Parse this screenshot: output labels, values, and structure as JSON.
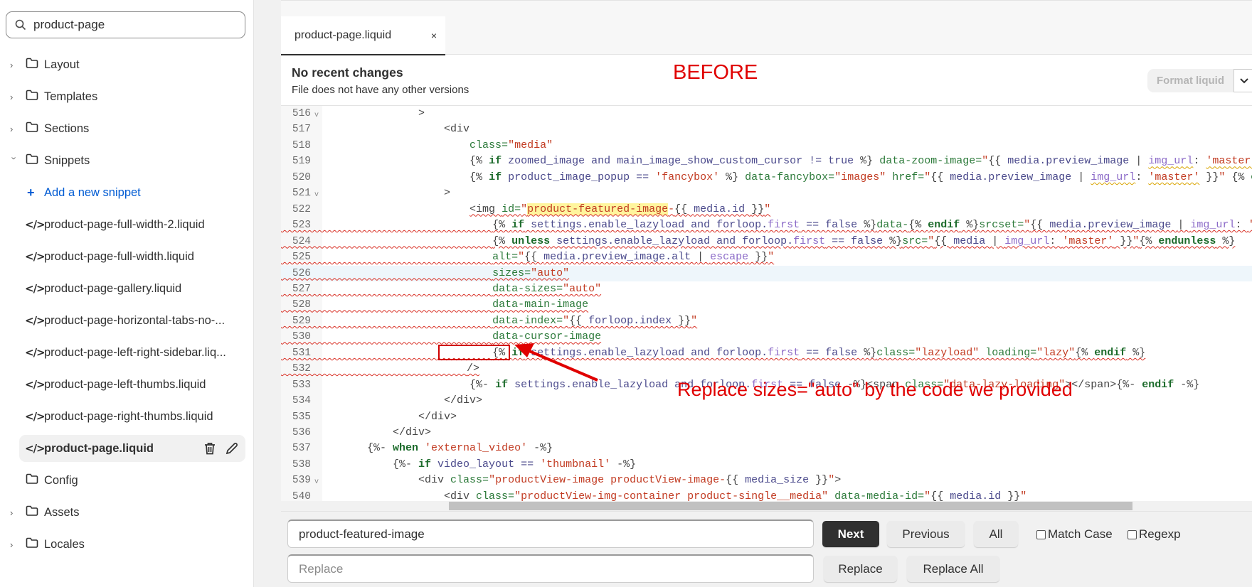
{
  "sidebar": {
    "search_value": "product-page",
    "items": [
      {
        "label": "Layout",
        "type": "folder",
        "chevron": "right"
      },
      {
        "label": "Templates",
        "type": "folder",
        "chevron": "right"
      },
      {
        "label": "Sections",
        "type": "folder",
        "chevron": "right"
      },
      {
        "label": "Snippets",
        "type": "folder",
        "chevron": "down"
      },
      {
        "label": "Add a new snippet",
        "type": "add"
      },
      {
        "label": "product-page-full-width-2.liquid",
        "type": "file"
      },
      {
        "label": "product-page-full-width.liquid",
        "type": "file"
      },
      {
        "label": "product-page-gallery.liquid",
        "type": "file"
      },
      {
        "label": "product-page-horizontal-tabs-no-...",
        "type": "file"
      },
      {
        "label": "product-page-left-right-sidebar.liq...",
        "type": "file"
      },
      {
        "label": "product-page-left-thumbs.liquid",
        "type": "file"
      },
      {
        "label": "product-page-right-thumbs.liquid",
        "type": "file"
      },
      {
        "label": "product-page.liquid",
        "type": "file",
        "active": true
      },
      {
        "label": "Config",
        "type": "folder",
        "chevron": "none"
      },
      {
        "label": "Assets",
        "type": "folder",
        "chevron": "right"
      },
      {
        "label": "Locales",
        "type": "folder",
        "chevron": "right"
      }
    ]
  },
  "editor": {
    "tab_label": "product-page.liquid",
    "tab_close": "×",
    "status_title": "No recent changes",
    "status_sub": "File does not have any other versions",
    "format_label": "Format liquid",
    "current_line": 526,
    "lines": [
      {
        "n": 516,
        "fold": true,
        "i": 14,
        "tk": [
          [
            "p",
            ">"
          ]
        ]
      },
      {
        "n": 517,
        "i": 18,
        "tk": [
          [
            "p",
            "<div"
          ]
        ]
      },
      {
        "n": 518,
        "i": 22,
        "tk": [
          [
            "t",
            "class="
          ],
          [
            "s",
            "\"media\""
          ]
        ]
      },
      {
        "n": 519,
        "i": 22,
        "tk": [
          [
            "p",
            "{% "
          ],
          [
            "k",
            "if"
          ],
          [
            "v",
            " zoomed_image and main_image_show_custom_cursor != true "
          ],
          [
            "p",
            "%} "
          ],
          [
            "t",
            "data-zoom-image="
          ],
          [
            "s",
            "\""
          ],
          [
            "p",
            "{{ "
          ],
          [
            "v",
            "media.preview_image "
          ],
          [
            "p",
            "| "
          ],
          [
            "fw",
            "img_url"
          ],
          [
            "p",
            ": "
          ],
          [
            "sw",
            "'master'"
          ],
          [
            "p",
            " }}"
          ],
          [
            "s",
            "\""
          ]
        ]
      },
      {
        "n": 520,
        "i": 22,
        "tk": [
          [
            "p",
            "{% "
          ],
          [
            "k",
            "if"
          ],
          [
            "v",
            " product_image_popup == "
          ],
          [
            "s",
            "'fancybox'"
          ],
          [
            "p",
            " %} "
          ],
          [
            "t",
            "data-fancybox="
          ],
          [
            "s",
            "\"images\""
          ],
          [
            "t",
            " href="
          ],
          [
            "s",
            "\""
          ],
          [
            "p",
            "{{ "
          ],
          [
            "v",
            "media.preview_image "
          ],
          [
            "p",
            "| "
          ],
          [
            "fw",
            "img_url"
          ],
          [
            "p",
            ": "
          ],
          [
            "sw",
            "'master'"
          ],
          [
            "p",
            " }}"
          ],
          [
            "s",
            "\""
          ],
          [
            "p",
            " {% "
          ],
          [
            "k",
            "endif"
          ],
          [
            "p",
            " %}"
          ]
        ]
      },
      {
        "n": 521,
        "fold": true,
        "i": 18,
        "tk": [
          [
            "p",
            ">"
          ]
        ]
      },
      {
        "n": 522,
        "i": 22,
        "err": "content",
        "tk": [
          [
            "p",
            "<img "
          ],
          [
            "t",
            "id="
          ],
          [
            "s",
            "\""
          ],
          [
            "sh",
            "product-featured-image"
          ],
          [
            "s",
            "-"
          ],
          [
            "p",
            "{{ "
          ],
          [
            "v",
            "media.id "
          ],
          [
            "p",
            "}}"
          ],
          [
            "s",
            "\""
          ]
        ]
      },
      {
        "n": 523,
        "i": 26,
        "err": "all",
        "tk": [
          [
            "p",
            "{% "
          ],
          [
            "k",
            "if"
          ],
          [
            "v",
            " settings.enable_lazyload and forloop."
          ],
          [
            "f",
            "first"
          ],
          [
            "v",
            " == false "
          ],
          [
            "p",
            "%}"
          ],
          [
            "t",
            "data-"
          ],
          [
            "p",
            "{% "
          ],
          [
            "k",
            "endif"
          ],
          [
            "p",
            " %}"
          ],
          [
            "t",
            "srcset="
          ],
          [
            "s",
            "\""
          ],
          [
            "p",
            "{{ "
          ],
          [
            "v",
            "media.preview_image "
          ],
          [
            "p",
            "| "
          ],
          [
            "f",
            "img_url"
          ],
          [
            "p",
            ": "
          ],
          [
            "s",
            "'master'"
          ],
          [
            "p",
            " }}"
          ],
          [
            "s",
            "\""
          ]
        ]
      },
      {
        "n": 524,
        "i": 26,
        "err": "all",
        "tk": [
          [
            "p",
            "{% "
          ],
          [
            "k",
            "unless"
          ],
          [
            "v",
            " settings.enable_lazyload and forloop."
          ],
          [
            "f",
            "first"
          ],
          [
            "v",
            " == false "
          ],
          [
            "p",
            "%}"
          ],
          [
            "t",
            "src="
          ],
          [
            "s",
            "\""
          ],
          [
            "p",
            "{{ "
          ],
          [
            "v",
            "media "
          ],
          [
            "p",
            "| "
          ],
          [
            "f",
            "img_url"
          ],
          [
            "p",
            ": "
          ],
          [
            "s",
            "'master'"
          ],
          [
            "p",
            " }}"
          ],
          [
            "s",
            "\""
          ],
          [
            "p",
            "{% "
          ],
          [
            "k",
            "endunless"
          ],
          [
            "p",
            " %}"
          ]
        ]
      },
      {
        "n": 525,
        "i": 26,
        "err": "all",
        "tk": [
          [
            "t",
            "alt="
          ],
          [
            "s",
            "\""
          ],
          [
            "p",
            "{{ "
          ],
          [
            "v",
            "media.preview_image.alt "
          ],
          [
            "p",
            "| "
          ],
          [
            "f",
            "escape"
          ],
          [
            "p",
            " }}"
          ],
          [
            "s",
            "\""
          ]
        ]
      },
      {
        "n": 526,
        "i": 26,
        "err": "all",
        "tk": [
          [
            "t",
            "sizes="
          ],
          [
            "s",
            "\"auto\""
          ]
        ]
      },
      {
        "n": 527,
        "i": 26,
        "err": "all",
        "tk": [
          [
            "t",
            "data-sizes="
          ],
          [
            "s",
            "\"auto\""
          ]
        ]
      },
      {
        "n": 528,
        "i": 26,
        "err": "all",
        "tk": [
          [
            "t",
            "data-main-image"
          ]
        ]
      },
      {
        "n": 529,
        "i": 26,
        "err": "all",
        "tk": [
          [
            "t",
            "data-index="
          ],
          [
            "s",
            "\""
          ],
          [
            "p",
            "{{ "
          ],
          [
            "v",
            "forloop.index "
          ],
          [
            "p",
            "}}"
          ],
          [
            "s",
            "\""
          ]
        ]
      },
      {
        "n": 530,
        "i": 26,
        "err": "all",
        "tk": [
          [
            "t",
            "data-cursor-image"
          ]
        ]
      },
      {
        "n": 531,
        "i": 26,
        "err": "all",
        "tk": [
          [
            "p",
            "{% "
          ],
          [
            "k",
            "if"
          ],
          [
            "v",
            " settings.enable_lazyload and forloop."
          ],
          [
            "f",
            "first"
          ],
          [
            "v",
            " == false "
          ],
          [
            "p",
            "%}"
          ],
          [
            "t",
            "class="
          ],
          [
            "s",
            "\"lazyload\""
          ],
          [
            "t",
            " loading="
          ],
          [
            "s",
            "\"lazy\""
          ],
          [
            "p",
            "{% "
          ],
          [
            "k",
            "endif"
          ],
          [
            "p",
            " %}"
          ]
        ]
      },
      {
        "n": 532,
        "i": 22,
        "err": "all",
        "tk": [
          [
            "p",
            "/>"
          ]
        ]
      },
      {
        "n": 533,
        "i": 22,
        "tk": [
          [
            "p",
            "{%- "
          ],
          [
            "k",
            "if"
          ],
          [
            "v",
            " settings.enable_lazyload and forloop."
          ],
          [
            "f",
            "first"
          ],
          [
            "v",
            " == false "
          ],
          [
            "p",
            "-%}<span "
          ],
          [
            "t",
            "class="
          ],
          [
            "s",
            "\"data-lazy-loading\""
          ],
          [
            "p",
            "></span>{%- "
          ],
          [
            "k",
            "endif"
          ],
          [
            "p",
            " -%}"
          ]
        ]
      },
      {
        "n": 534,
        "i": 18,
        "tk": [
          [
            "p",
            "</div>"
          ]
        ]
      },
      {
        "n": 535,
        "i": 14,
        "tk": [
          [
            "p",
            "</div>"
          ]
        ]
      },
      {
        "n": 536,
        "i": 10,
        "tk": [
          [
            "p",
            "</div>"
          ]
        ]
      },
      {
        "n": 537,
        "i": 6,
        "tk": [
          [
            "p",
            "{%- "
          ],
          [
            "k",
            "when"
          ],
          [
            "s",
            " 'external_video'"
          ],
          [
            "p",
            " -%}"
          ]
        ]
      },
      {
        "n": 538,
        "i": 10,
        "tk": [
          [
            "p",
            "{%- "
          ],
          [
            "k",
            "if"
          ],
          [
            "v",
            " video_layout == "
          ],
          [
            "s",
            "'thumbnail'"
          ],
          [
            "p",
            " -%}"
          ]
        ]
      },
      {
        "n": 539,
        "fold": true,
        "i": 14,
        "tk": [
          [
            "p",
            "<div "
          ],
          [
            "t",
            "class="
          ],
          [
            "s",
            "\"productView-image productView-image-"
          ],
          [
            "p",
            "{{ "
          ],
          [
            "v",
            "media_size "
          ],
          [
            "p",
            "}}"
          ],
          [
            "s",
            "\""
          ],
          [
            "p",
            ">"
          ]
        ]
      },
      {
        "n": 540,
        "i": 18,
        "tk": [
          [
            "p",
            "<div "
          ],
          [
            "t",
            "class="
          ],
          [
            "s",
            "\"productView-img-container product-single__media\""
          ],
          [
            "t",
            " data-media-id="
          ],
          [
            "s",
            "\""
          ],
          [
            "p",
            "{{ "
          ],
          [
            "v",
            "media.id "
          ],
          [
            "p",
            "}}"
          ],
          [
            "s",
            "\""
          ]
        ]
      }
    ]
  },
  "annotation": {
    "before_label": "BEFORE",
    "note": "Replace sizes=\"auto\" by the code we provided",
    "color": "#e00000"
  },
  "find": {
    "find_value": "product-featured-image",
    "replace_placeholder": "Replace",
    "next": "Next",
    "previous": "Previous",
    "all": "All",
    "match_case": "Match Case",
    "regexp": "Regexp",
    "replace": "Replace",
    "replace_all": "Replace All"
  }
}
